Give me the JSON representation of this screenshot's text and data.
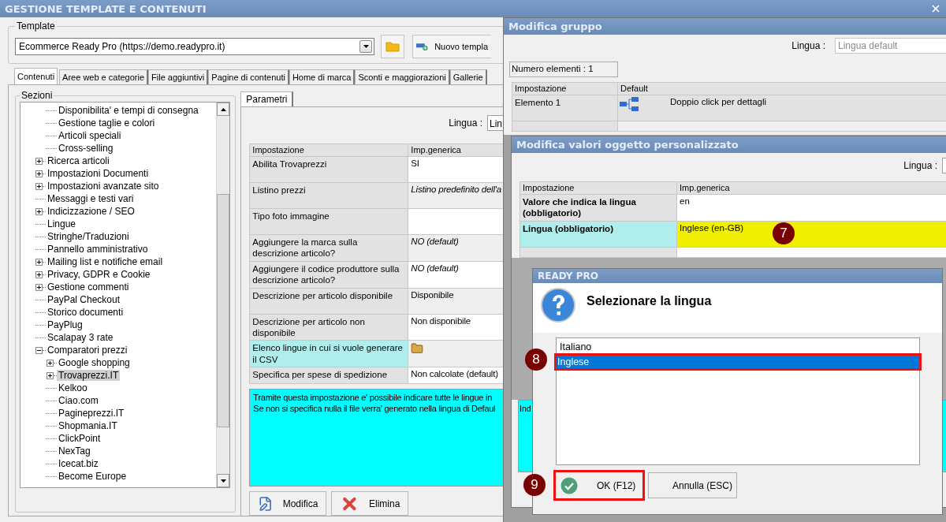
{
  "window": {
    "title": "GESTIONE TEMPLATE E CONTENUTI"
  },
  "template": {
    "label": "Template",
    "value": "Ecommerce Ready Pro (https://demo.readypro.it)",
    "new_button": "Nuovo templa"
  },
  "tabs": [
    {
      "label": "Contenuti",
      "selected": true
    },
    {
      "label": "Aree web e categorie",
      "selected": false
    },
    {
      "label": "File aggiuntivi",
      "selected": false
    },
    {
      "label": "Pagine di contenuti",
      "selected": false
    },
    {
      "label": "Home di marca",
      "selected": false
    },
    {
      "label": "Sconti e maggiorazioni",
      "selected": false
    },
    {
      "label": "Gallerie",
      "selected": false
    }
  ],
  "sections": {
    "title": "Sezioni",
    "tree": [
      {
        "children": [
          {
            "label": "Disponibilita' e tempi di consegna",
            "selected": false
          },
          {
            "label": "Gestione taglie e colori",
            "selected": false
          },
          {
            "label": "Articoli speciali",
            "selected": false
          },
          {
            "label": "Cross-selling",
            "selected": false
          }
        ]
      },
      {
        "label": "Ricerca articoli",
        "expanded": false,
        "selected": false
      },
      {
        "label": "Impostazioni Documenti",
        "expanded": false,
        "selected": false
      },
      {
        "label": "Impostazioni avanzate sito",
        "expanded": false,
        "selected": false
      },
      {
        "label": "Messaggi e testi vari",
        "selected": false
      },
      {
        "label": "Indicizzazione / SEO",
        "expanded": false,
        "selected": false
      },
      {
        "label": "Lingue",
        "selected": false
      },
      {
        "label": "Stringhe/Traduzioni",
        "selected": false
      },
      {
        "label": "Pannello amministrativo",
        "selected": false
      },
      {
        "label": "Mailing list e notifiche email",
        "expanded": false,
        "selected": false
      },
      {
        "label": "Privacy, GDPR e Cookie",
        "expanded": false,
        "selected": false
      },
      {
        "label": "Gestione commenti",
        "expanded": false,
        "selected": false
      },
      {
        "label": "PayPal Checkout",
        "selected": false
      },
      {
        "label": "Storico documenti",
        "selected": false
      },
      {
        "label": "PayPlug",
        "selected": false
      },
      {
        "label": "Scalapay 3 rate",
        "selected": false
      },
      {
        "label": "Comparatori prezzi",
        "expanded": true,
        "selected": false,
        "children": [
          {
            "label": "Google shopping",
            "expanded": false,
            "selected": false
          },
          {
            "label": "Trovaprezzi.IT",
            "expanded": false,
            "selected": true
          },
          {
            "label": "Kelkoo",
            "selected": false
          },
          {
            "label": "Ciao.com",
            "selected": false
          },
          {
            "label": "Pagineprezzi.IT",
            "selected": false
          },
          {
            "label": "Shopmania.IT",
            "selected": false
          },
          {
            "label": "ClickPoint",
            "selected": false
          },
          {
            "label": "NexTag",
            "selected": false
          },
          {
            "label": "Icecat.biz",
            "selected": false
          },
          {
            "label": "Become Europe",
            "selected": false
          }
        ]
      }
    ]
  },
  "parameters": {
    "tab": "Parametri",
    "language_label": "Lingua :",
    "language_value": "Lin",
    "columns": [
      "Impostazione",
      "Imp.generica"
    ],
    "rows": [
      {
        "label": "Abilita Trovaprezzi",
        "kind": "text",
        "value": "SI",
        "italic": false,
        "highlighted": false
      },
      {
        "label": "Listino prezzi",
        "kind": "text",
        "value": "Listino predefinito dell'a",
        "italic": true,
        "highlighted": false
      },
      {
        "label": "Tipo foto immagine",
        "kind": "empty",
        "highlighted": false
      },
      {
        "label": "Aggiungere la marca sulla descrizione articolo?",
        "kind": "text",
        "value": "NO (default)",
        "italic": true,
        "highlighted": false
      },
      {
        "label": "Aggiungere il codice produttore sulla descrizione articolo?",
        "kind": "text",
        "value": "NO (default)",
        "italic": true,
        "highlighted": false
      },
      {
        "label": "Descrizione per articolo disponibile",
        "kind": "text",
        "value": "Disponibile",
        "italic": false,
        "highlighted": false
      },
      {
        "label": "Descrizione per articolo non disponibile",
        "kind": "text",
        "value": "Non disponibile",
        "italic": false,
        "highlighted": false
      },
      {
        "label": "Elenco lingue in cui si vuole generare il CSV",
        "kind": "folder",
        "highlighted": true
      },
      {
        "label": "Specifica per spese di spedizione",
        "kind": "text",
        "value": "Non calcolate (default)",
        "italic": false,
        "highlighted": false
      }
    ],
    "description": [
      "Tramite questa impostazione e' possibile indicare tutte le lingue in",
      "Se non si specifica nulla il file verra' generato nella lingua di Defaul"
    ],
    "buttons": [
      {
        "label": "Modifica",
        "kind": "edit"
      },
      {
        "label": "Elimina",
        "kind": "delete"
      }
    ]
  },
  "group_window": {
    "title": "Modifica gruppo",
    "language_label": "Lingua :",
    "language_placeholder": "Lingua default",
    "count": "Numero elementi : 1",
    "columns": [
      "Impostazione",
      "Default"
    ],
    "rows": [
      {
        "label": "Elemento 1",
        "value": "Doppio click per dettagli"
      }
    ]
  },
  "object_window": {
    "title": "Modifica valori oggetto personalizzato",
    "language_label": "Lingua :",
    "columns": [
      "Impostazione",
      "Imp.generica"
    ],
    "rows": [
      {
        "label": "Valore che indica la lingua (obbligatorio)",
        "value": "en",
        "highlighted": false
      },
      {
        "label": "Lingua (obbligatorio)",
        "value": "Inglese (en-GB)",
        "highlighted": true,
        "badge": "7"
      }
    ],
    "description": "Ind"
  },
  "dialog": {
    "title": "READY PRO",
    "message": "Selezionare la lingua",
    "options": [
      {
        "label": "Italiano",
        "selected": false,
        "outlined": false
      },
      {
        "label": "Inglese",
        "selected": true,
        "outlined": true,
        "badge": "8"
      }
    ],
    "buttons": [
      {
        "label": "OK (F12)",
        "kind": "ok",
        "outlined": true,
        "badge": "9"
      },
      {
        "label": "Annulla (ESC)",
        "kind": "cancel",
        "outlined": false
      }
    ]
  }
}
